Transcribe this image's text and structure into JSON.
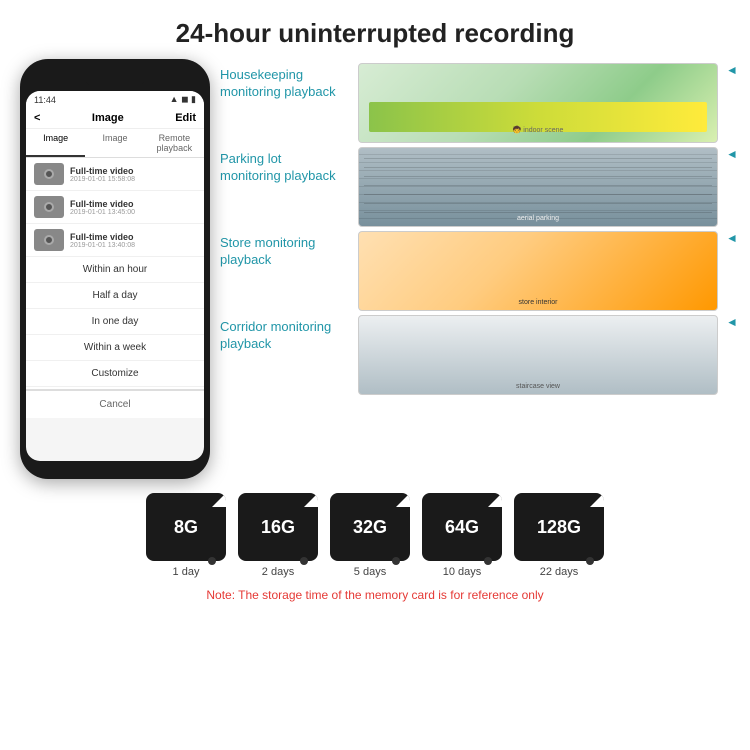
{
  "page": {
    "title": "24-hour uninterrupted recording"
  },
  "phone": {
    "time": "11:44",
    "header_title": "Image",
    "header_back": "<",
    "header_edit": "Edit",
    "tabs": [
      "Image",
      "Image",
      "Remote playback"
    ],
    "list_items": [
      {
        "title": "Full-time video",
        "date": "2019-01-01 15:58:08"
      },
      {
        "title": "Full-time video",
        "date": "2019-01-01 13:45:00"
      },
      {
        "title": "Full-time video",
        "date": "2019-01-01 13:40:08"
      }
    ],
    "dropdown": [
      {
        "label": "Within an hour",
        "selected": false
      },
      {
        "label": "Half a day",
        "selected": false
      },
      {
        "label": "In one day",
        "selected": false
      },
      {
        "label": "Within a week",
        "selected": false
      },
      {
        "label": "Customize",
        "selected": false
      }
    ],
    "cancel_label": "Cancel"
  },
  "monitoring": [
    {
      "label": "Housekeeping\nmonitoring playback",
      "img_class": "img-housekeeping"
    },
    {
      "label": "Parking lot\nmonitoring playback",
      "img_class": "img-parking"
    },
    {
      "label": "Store monitoring\nplayback",
      "img_class": "img-store"
    },
    {
      "label": "Corridor monitoring\nplayback",
      "img_class": "img-corridor"
    }
  ],
  "storage": {
    "cards": [
      {
        "size": "8G",
        "days": "1 day"
      },
      {
        "size": "16G",
        "days": "2 days"
      },
      {
        "size": "32G",
        "days": "5 days"
      },
      {
        "size": "64G",
        "days": "10 days"
      },
      {
        "size": "128G",
        "days": "22 days"
      }
    ],
    "note": "Note: The storage time of the memory card is for reference only"
  }
}
